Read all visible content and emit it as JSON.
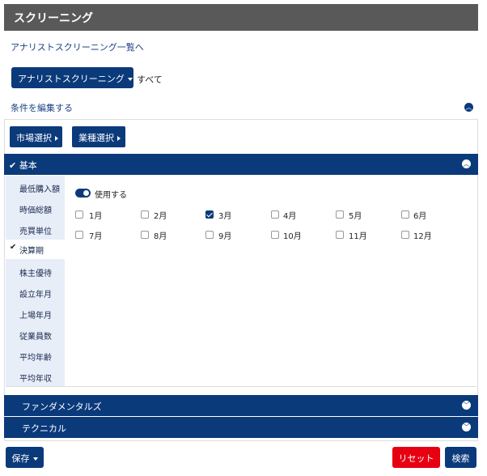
{
  "header": {
    "title": "スクリーニング"
  },
  "nav": {
    "list_link": "アナリストスクリーニング一覧へ"
  },
  "screening_type": {
    "selected": "アナリストスクリーニング",
    "scope": "すべて"
  },
  "conditions": {
    "edit_label": "条件を編集する"
  },
  "filters": {
    "market_button": "市場選択",
    "industry_button": "業種選択"
  },
  "sections": {
    "basic": "基本",
    "fundamentals": "ファンダメンタルズ",
    "technical": "テクニカル"
  },
  "sidebar": {
    "items": [
      {
        "label": "最低購入額"
      },
      {
        "label": "時価総額"
      },
      {
        "label": "売買単位"
      },
      {
        "label": "決算期"
      },
      {
        "label": "株主優待"
      },
      {
        "label": "設立年月"
      },
      {
        "label": "上場年月"
      },
      {
        "label": "従業員数"
      },
      {
        "label": "平均年齢"
      },
      {
        "label": "平均年収"
      }
    ],
    "active_index": 3
  },
  "settlement": {
    "use_label": "使用する",
    "use_enabled": true,
    "months": [
      {
        "label": "1月",
        "checked": false
      },
      {
        "label": "2月",
        "checked": false
      },
      {
        "label": "3月",
        "checked": true
      },
      {
        "label": "4月",
        "checked": false
      },
      {
        "label": "5月",
        "checked": false
      },
      {
        "label": "6月",
        "checked": false
      },
      {
        "label": "7月",
        "checked": false
      },
      {
        "label": "8月",
        "checked": false
      },
      {
        "label": "9月",
        "checked": false
      },
      {
        "label": "10月",
        "checked": false
      },
      {
        "label": "11月",
        "checked": false
      },
      {
        "label": "12月",
        "checked": false
      }
    ]
  },
  "footer": {
    "save_label": "保存",
    "reset_label": "リセット",
    "search_label": "検索"
  },
  "colors": {
    "primary": "#0b3a7b",
    "header_bg": "#5a595a",
    "reset": "#e60012",
    "sidebar_bg": "#e8eef8"
  },
  "icons": [
    "caret-down-icon",
    "chevron-up-icon",
    "chevron-down-icon",
    "triangle-right-icon",
    "check-icon"
  ]
}
